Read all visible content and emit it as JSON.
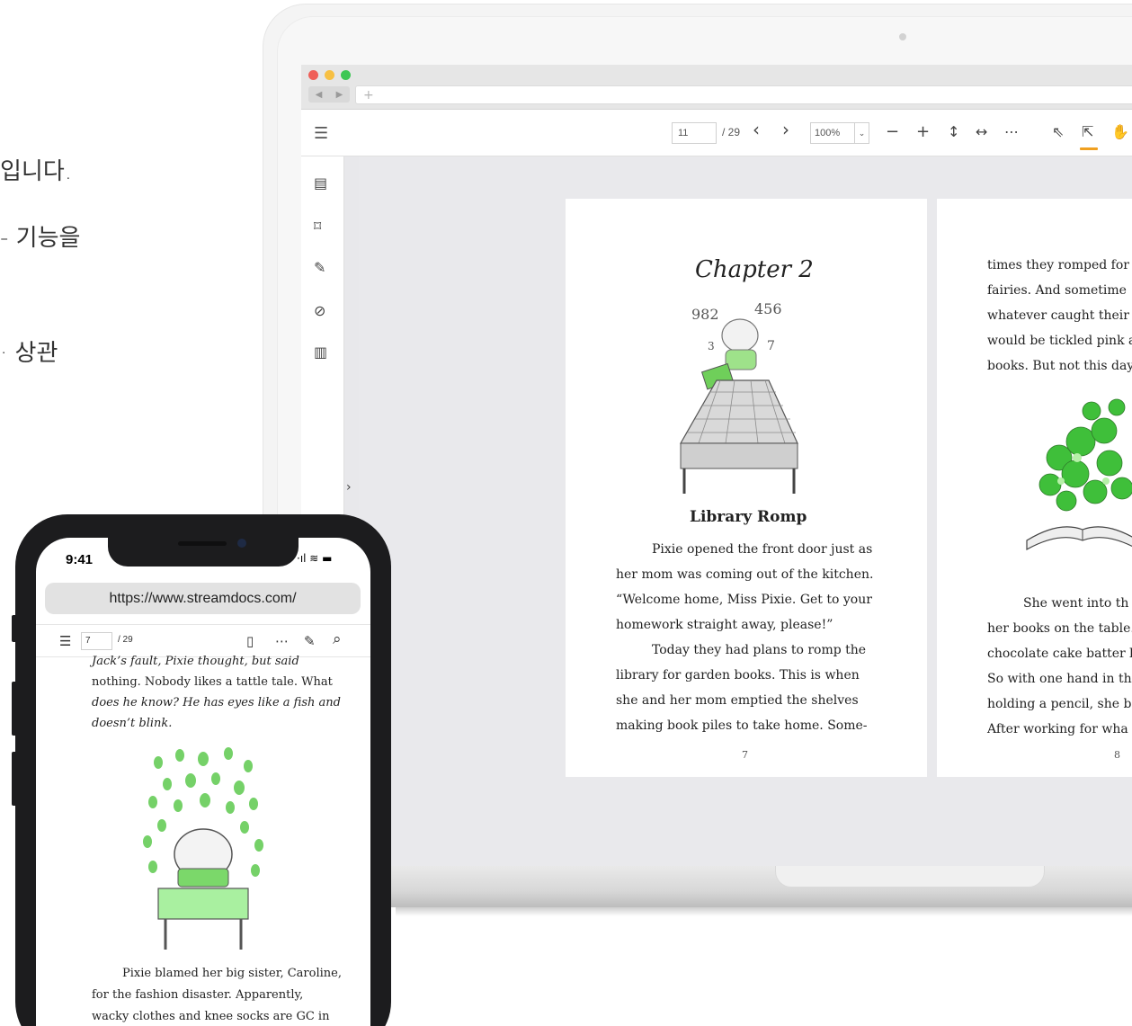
{
  "marketing": {
    "line1": "입니다.",
    "line2": "- 기능을",
    "line3": "· 상관"
  },
  "laptop": {
    "viewer": {
      "current_page": "11",
      "total_pages": "/ 29",
      "prev_icon": "‹",
      "next_icon": "›",
      "zoom": "100%",
      "zoom_caret": "⌄",
      "icons": {
        "menu": "☰",
        "zoom_out": "−",
        "zoom_in": "+",
        "fit_height": "↕",
        "fit_width": "↔",
        "more": "⋯",
        "select": "⇖",
        "text_select": "⇱",
        "pan": "✋"
      },
      "sidebar_icons": [
        "▤",
        "⌑",
        "✎",
        "⊘",
        "▥"
      ],
      "collapse_icon": "›"
    },
    "left_page": {
      "chapter": "Chapter 2",
      "title": "Library Romp",
      "lines": [
        "Pixie opened the front door just as",
        "her mom was coming out of the kitchen.",
        "“Welcome home, Miss Pixie. Get to your",
        "homework straight away, please!”",
        "Today they had plans to romp the",
        "library for garden books. This is when",
        "she and her mom emptied the shelves",
        "making book piles to take home. Some-"
      ],
      "page_number": "7"
    },
    "right_page": {
      "top_lines": [
        "times they romped for",
        "fairies. And sometime",
        "whatever caught their",
        "would be tickled pink a",
        "books. But not this day"
      ],
      "bottom_lines": [
        "She went into th",
        "her books on the table.",
        "chocolate cake batter l",
        "So with one hand in th",
        "holding a pencil, she b",
        "After working for wha"
      ],
      "page_number": "8"
    }
  },
  "phone": {
    "time": "9:41",
    "status": "·ıl ≋ ▬",
    "url": "https://www.streamdocs.com/",
    "current_page": "7",
    "total_pages": "/ 29",
    "icons": {
      "menu": "☰",
      "layout": "▯",
      "more": "⋯",
      "edit": "✎",
      "search": "⌕"
    },
    "text_top": [
      "Jack’s fault, Pixie thought,  but said",
      "nothing. Nobody likes a tattle tale. What",
      "does he know? He has eyes like a fish and",
      "doesn’t blink."
    ],
    "text_bottom": [
      "Pixie blamed her big sister, Caroline,",
      "for the fashion disaster. Apparently,",
      "wacky clothes and knee socks are GC in"
    ]
  }
}
